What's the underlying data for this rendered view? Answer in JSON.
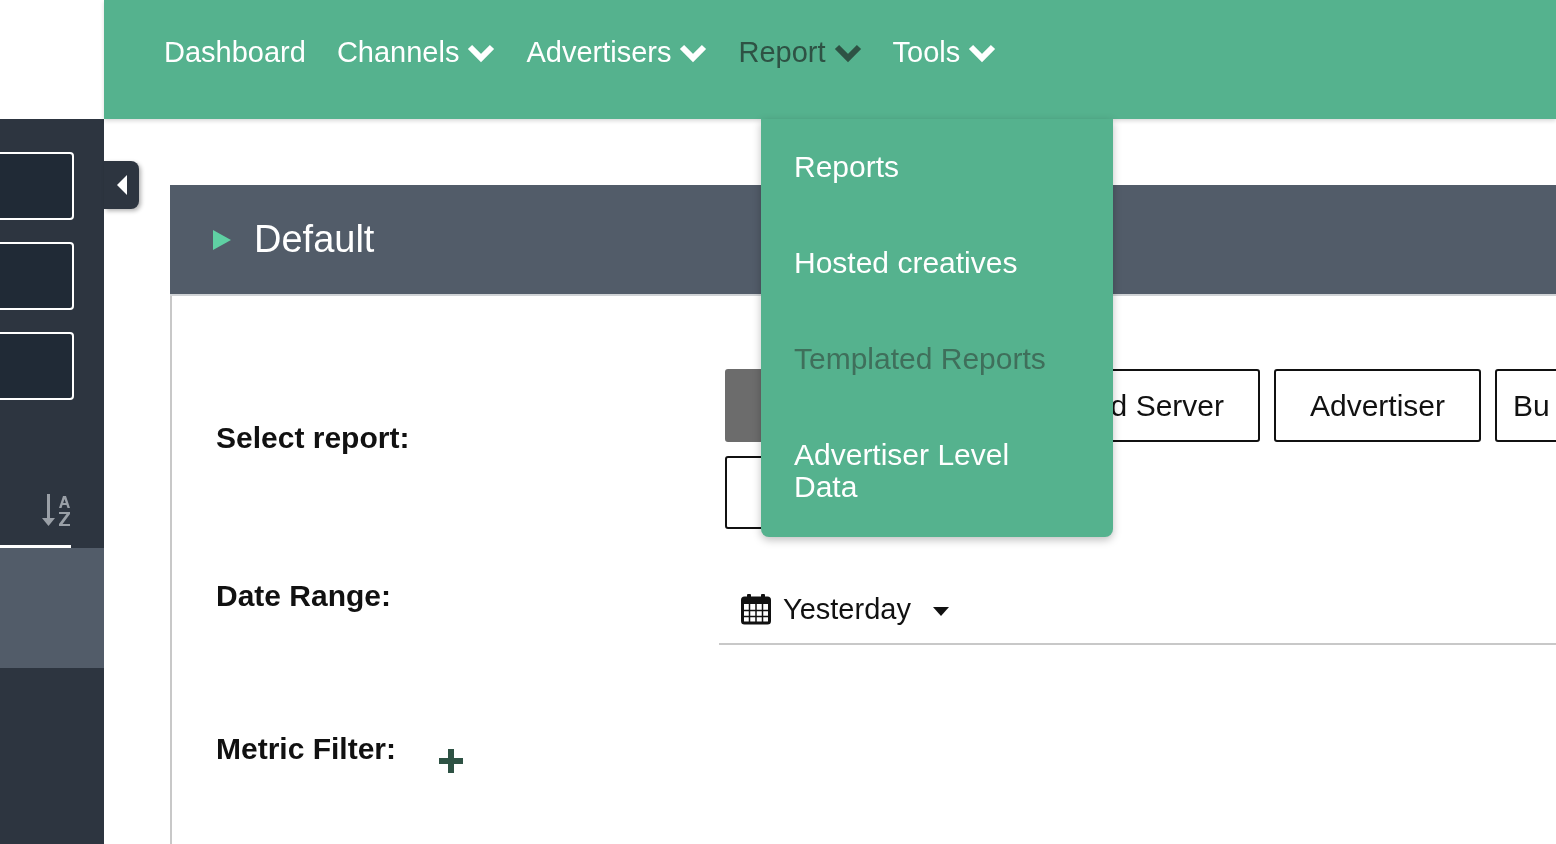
{
  "nav": {
    "items": [
      {
        "label": "Dashboard",
        "has_caret": false,
        "selected": false
      },
      {
        "label": "Channels",
        "has_caret": true,
        "selected": false
      },
      {
        "label": "Advertisers",
        "has_caret": true,
        "selected": false
      },
      {
        "label": "Report",
        "has_caret": true,
        "selected": true
      },
      {
        "label": "Tools",
        "has_caret": true,
        "selected": false
      }
    ]
  },
  "dropdown": {
    "items": [
      {
        "label": "Reports",
        "selected": false
      },
      {
        "label": "Hosted creatives",
        "selected": false
      },
      {
        "label": "Templated Reports",
        "selected": true
      },
      {
        "label": "Advertiser Level Data",
        "selected": false
      }
    ]
  },
  "panel": {
    "title": "Default",
    "expanded": false
  },
  "form": {
    "select_report": {
      "label": "Select report:",
      "options": [
        {
          "selected": true
        },
        {
          "label": "d Server",
          "selected": false
        },
        {
          "label": "Advertiser",
          "selected": false
        },
        {
          "label": "Bu",
          "selected": false
        },
        {
          "selected": false
        }
      ]
    },
    "date_range": {
      "label": "Date Range:",
      "value": "Yesterday"
    },
    "metric_filter": {
      "label": "Metric Filter:"
    }
  }
}
